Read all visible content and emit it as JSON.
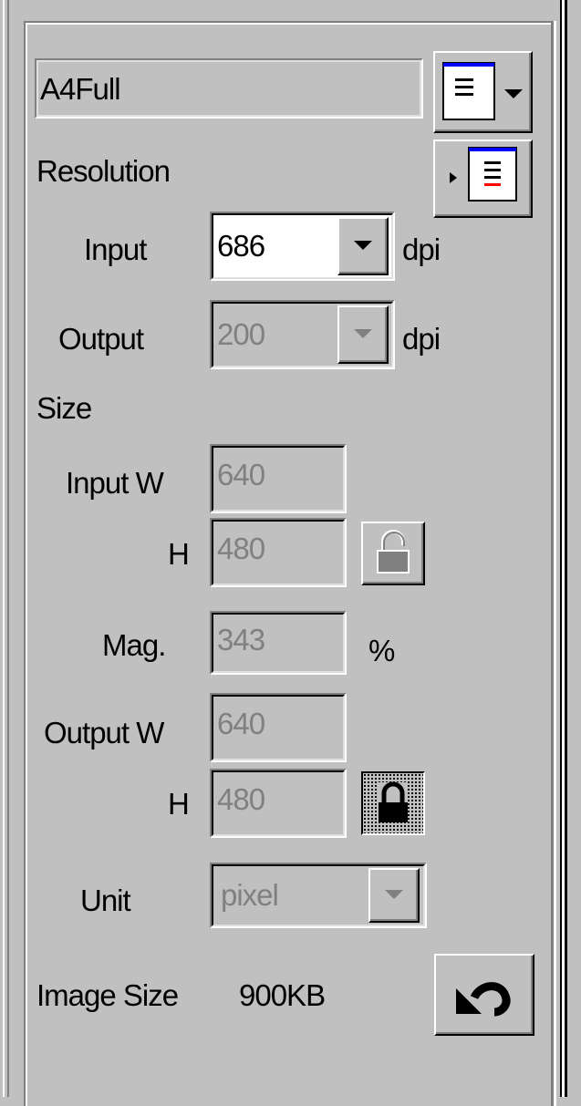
{
  "preset": {
    "value": "A4Full"
  },
  "resolution": {
    "heading": "Resolution",
    "input_label": "Input",
    "input_value": "686",
    "input_unit": "dpi",
    "output_label": "Output",
    "output_value": "200",
    "output_unit": "dpi"
  },
  "size": {
    "heading": "Size",
    "input_w_label": "Input W",
    "input_w_value": "640",
    "input_h_label": "H",
    "input_h_value": "480",
    "mag_label": "Mag.",
    "mag_value": "343",
    "mag_unit": "%",
    "output_w_label": "Output W",
    "output_w_value": "640",
    "output_h_label": "H",
    "output_h_value": "480"
  },
  "unit": {
    "label": "Unit",
    "value": "pixel"
  },
  "image_size": {
    "label": "Image Size",
    "value": "900KB"
  },
  "icons": {
    "preset_menu": "list-menu-icon",
    "apply_preset": "play-list-icon",
    "input_lock": "unlocked-padlock-icon",
    "output_lock": "locked-padlock-icon",
    "reset": "undo-arrow-icon"
  },
  "colors": {
    "face": "#c0c0c0",
    "shadow": "#808080",
    "highlight": "#ffffff",
    "accent_blue": "#0000ff",
    "accent_red": "#ff0000"
  }
}
